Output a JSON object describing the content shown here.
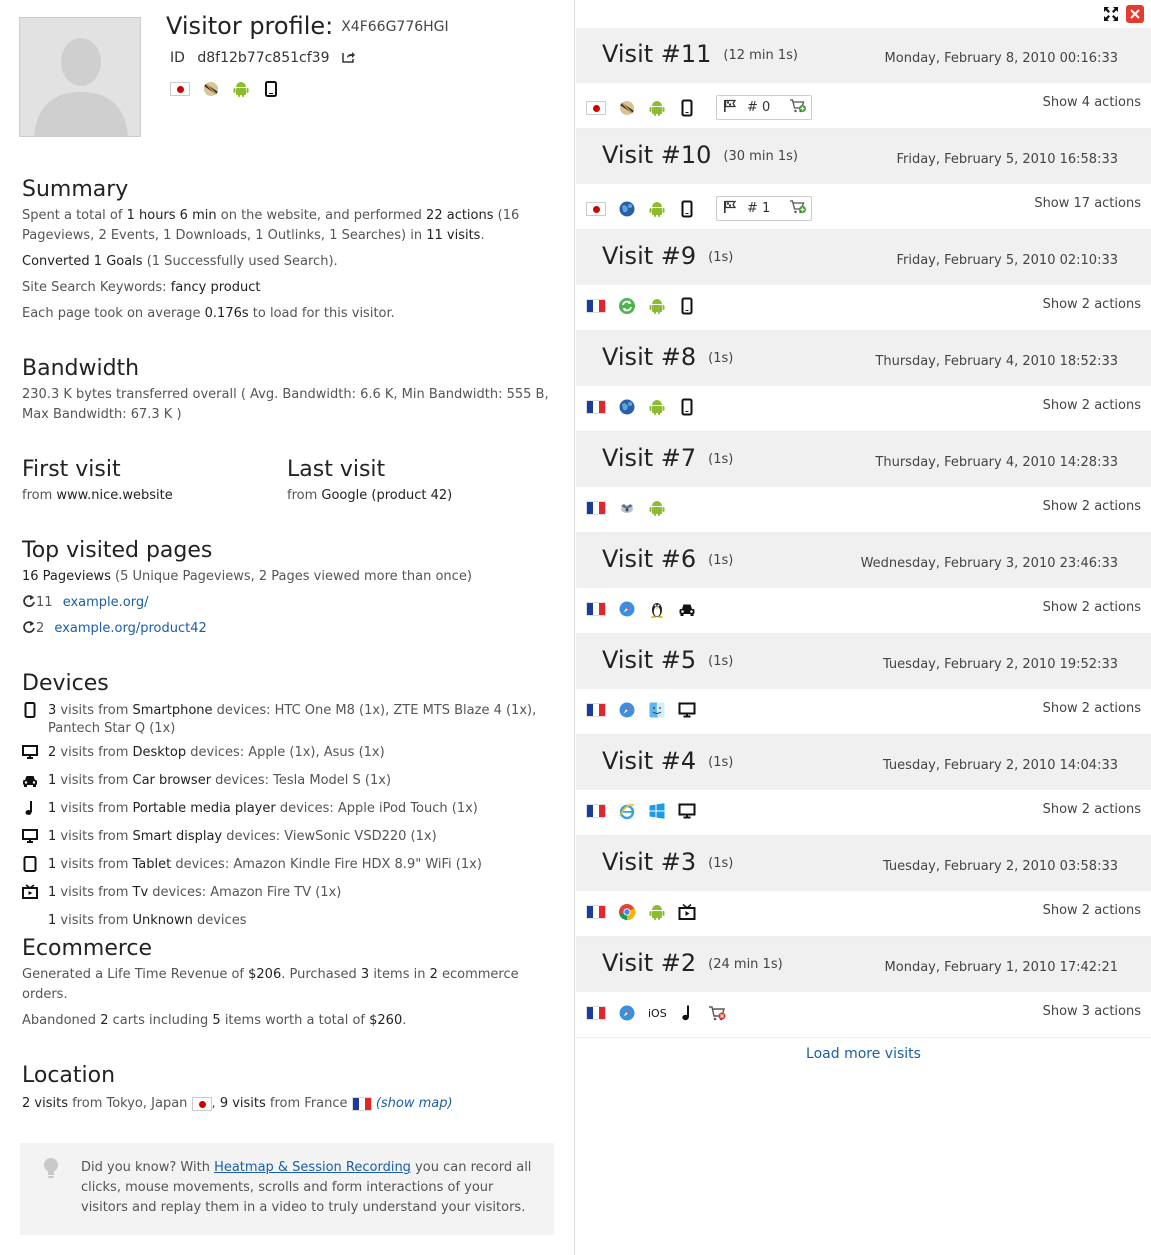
{
  "profile": {
    "title": "Visitor profile:",
    "visitor_id": "X4F66G776HGI",
    "id_label": "ID",
    "id_value": "d8f12b77c851cf39"
  },
  "summary": {
    "heading": "Summary",
    "line1": {
      "t1": "Spent a total of ",
      "v1": "1 hours 6 min",
      "t2": " on the website, and performed ",
      "v2": "22 actions",
      "t3": " (16 Pageviews, 2 Events, 1 Downloads, 1 Outlinks, 1 Searches) in ",
      "v3": "11 visits",
      "t4": "."
    },
    "line2": {
      "v1": "Converted 1 Goals",
      "t1": " (1 Successfully used Search)."
    },
    "line3": {
      "t1": "Site Search Keywords: ",
      "v1": "fancy product"
    },
    "line4": {
      "t1": "Each page took on average ",
      "v1": "0.176s",
      "t2": " to load for this visitor."
    }
  },
  "bandwidth": {
    "heading": "Bandwidth",
    "text": "230.3 K bytes transferred overall ( Avg. Bandwidth: 6.6 K, Min Bandwidth: 555 B, Max Bandwidth: 67.3 K )"
  },
  "first_visit": {
    "heading": "First visit",
    "from": "from",
    "value": "www.nice.website"
  },
  "last_visit": {
    "heading": "Last visit",
    "from": "from",
    "value": "Google (product 42)"
  },
  "top_pages": {
    "heading": "Top visited pages",
    "summary_v": "16 Pageviews",
    "summary_t": " (5 Unique Pageviews, 2 Pages viewed more than once)",
    "pages": [
      {
        "count": "11",
        "url": "example.org/"
      },
      {
        "count": "2",
        "url": "example.org/product42"
      }
    ]
  },
  "devices": {
    "heading": "Devices",
    "rows": [
      {
        "icon": "smartphone-icon",
        "count": "3",
        "t1": " visits from ",
        "type": "Smartphone",
        "t2": " devices: HTC One M8 (1x), ZTE MTS Blaze 4 (1x), Pantech Star Q (1x)"
      },
      {
        "icon": "desktop-icon",
        "count": "2",
        "t1": " visits from ",
        "type": "Desktop",
        "t2": " devices: Apple (1x), Asus (1x)"
      },
      {
        "icon": "car-icon",
        "count": "1",
        "t1": " visits from ",
        "type": "Car browser",
        "t2": " devices: Tesla Model S (1x)"
      },
      {
        "icon": "music-note-icon",
        "count": "1",
        "t1": " visits from ",
        "type": "Portable media player",
        "t2": " devices: Apple iPod Touch (1x)"
      },
      {
        "icon": "smart-display-icon",
        "count": "1",
        "t1": " visits from ",
        "type": "Smart display",
        "t2": " devices: ViewSonic VSD220 (1x)"
      },
      {
        "icon": "tablet-icon",
        "count": "1",
        "t1": " visits from ",
        "type": "Tablet",
        "t2": " devices: Amazon Kindle Fire HDX 8.9\" WiFi (1x)"
      },
      {
        "icon": "tv-icon",
        "count": "1",
        "t1": " visits from ",
        "type": "Tv",
        "t2": " devices: Amazon Fire TV (1x)"
      },
      {
        "icon": "",
        "count": "1",
        "t1": " visits from ",
        "type": "Unknown",
        "t2": " devices"
      }
    ]
  },
  "ecommerce": {
    "heading": "Ecommerce",
    "l1": {
      "t1": "Generated a Life Time Revenue of ",
      "v1": "$206",
      "t2": ". Purchased ",
      "v2": "3",
      "t3": " items in ",
      "v3": "2",
      "t4": " ecommerce orders."
    },
    "l2": {
      "t1": "Abandoned ",
      "v1": "2",
      "t2": " carts including ",
      "v2": "5",
      "t3": " items worth a total of ",
      "v3": "$260",
      "t4": "."
    }
  },
  "location": {
    "heading": "Location",
    "v1": "2 visits",
    "t1": " from Tokyo, Japan ",
    "v2": "9 visits",
    "t2": " from France ",
    "show_map": "(show map)"
  },
  "tip": {
    "t1": "Did you know? With ",
    "link": "Heatmap & Session Recording",
    "t2": " you can record all clicks, mouse movements, scrolls and form interactions of your visitors and replay them in a video to truly understand your visitors."
  },
  "visits": [
    {
      "title": "Visit #11",
      "duration": "(12 min 1s)",
      "date": "Monday, February 8, 2010 00:16:33",
      "flag": "jp",
      "icons": [
        "opera-icon",
        "android-icon",
        "smartphone-icon"
      ],
      "goal": "# 0",
      "actions": "Show 4 actions"
    },
    {
      "title": "Visit #10",
      "duration": "(30 min 1s)",
      "date": "Friday, February 5, 2010 16:58:33",
      "flag": "jp",
      "icons": [
        "globe-browser-icon",
        "android-icon",
        "smartphone-icon"
      ],
      "goal": "# 1",
      "actions": "Show 17 actions"
    },
    {
      "title": "Visit #9",
      "duration": "(1s)",
      "date": "Friday, February 5, 2010 02:10:33",
      "flag": "fr",
      "icons": [
        "refresh-browser-icon",
        "android-icon",
        "smartphone-icon"
      ],
      "goal": "",
      "actions": "Show 2 actions"
    },
    {
      "title": "Visit #8",
      "duration": "(1s)",
      "date": "Thursday, February 4, 2010 18:52:33",
      "flag": "fr",
      "icons": [
        "globe-browser-icon",
        "android-icon",
        "smartphone-icon"
      ],
      "goal": "",
      "actions": "Show 2 actions"
    },
    {
      "title": "Visit #7",
      "duration": "(1s)",
      "date": "Thursday, February 4, 2010 14:28:33",
      "flag": "fr",
      "icons": [
        "bird-browser-icon",
        "android-icon"
      ],
      "goal": "",
      "actions": "Show 2 actions"
    },
    {
      "title": "Visit #6",
      "duration": "(1s)",
      "date": "Wednesday, February 3, 2010 23:46:33",
      "flag": "fr",
      "icons": [
        "safari-icon",
        "linux-icon",
        "car-icon"
      ],
      "goal": "",
      "actions": "Show 2 actions"
    },
    {
      "title": "Visit #5",
      "duration": "(1s)",
      "date": "Tuesday, February 2, 2010 19:52:33",
      "flag": "fr",
      "icons": [
        "safari-icon",
        "mac-finder-icon",
        "desktop-icon"
      ],
      "goal": "",
      "actions": "Show 2 actions"
    },
    {
      "title": "Visit #4",
      "duration": "(1s)",
      "date": "Tuesday, February 2, 2010 14:04:33",
      "flag": "fr",
      "icons": [
        "ie-icon",
        "windows-icon",
        "desktop-icon"
      ],
      "goal": "",
      "actions": "Show 2 actions"
    },
    {
      "title": "Visit #3",
      "duration": "(1s)",
      "date": "Tuesday, February 2, 2010 03:58:33",
      "flag": "fr",
      "icons": [
        "chrome-icon",
        "android-icon",
        "tv-icon"
      ],
      "goal": "",
      "actions": "Show 2 actions"
    },
    {
      "title": "Visit #2",
      "duration": "(24 min 1s)",
      "date": "Monday, February 1, 2010 17:42:21",
      "flag": "fr",
      "icons": [
        "safari-icon",
        "ios-icon",
        "music-note-icon",
        "cart-abandoned-icon"
      ],
      "goal": "",
      "actions": "Show 3 actions"
    }
  ],
  "ios_label": "iOS",
  "load_more": "Load more visits"
}
